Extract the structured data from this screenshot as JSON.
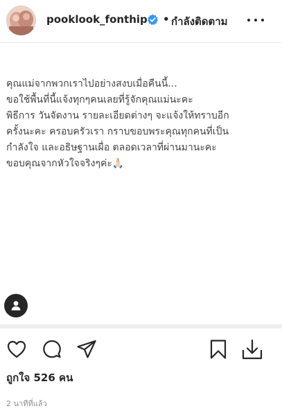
{
  "header": {
    "username": "pooklook_fonthip",
    "verified_icon": "verified-badge-icon",
    "separator": "•",
    "follow_status": "กำลังติดตาม",
    "more_icon": "more-options-icon"
  },
  "post": {
    "caption_lines": [
      "คุณแม่จากพวกเราไปอย่างสงบเมื่อคืนนี้...",
      "ขอใช้พื้นที่นี้แจ้งทุกๆคนเลยที่รู้จักคุณแม่นะคะ",
      "พิธีการ วันจัดงาน รายละเอียดต่างๆ จะแจ้งให้ทราบอีก",
      "ครั้งนะคะ ครอบครัวเรา กราบขอบพระคุณทุกคนที่เป็น",
      "กำลังใจ และอธิษฐานเผื่อ ตลอดเวลาที่ผ่านมานะคะ",
      "ขอบคุณจากหัวใจจริงๆค่ะ🙏🏻"
    ],
    "tag_icon": "user-tag-icon"
  },
  "actions": {
    "like_icon": "heart-icon",
    "comment_icon": "comment-icon",
    "share_icon": "paper-plane-icon",
    "save_icon": "bookmark-icon",
    "download_icon": "download-icon"
  },
  "stats": {
    "likes_text": "ถูกใจ 526 คน",
    "timestamp": "2 นาทีที่แล้ว"
  },
  "colors": {
    "text": "#262626",
    "caption": "#444444",
    "muted": "#8e8e8e",
    "verified": "#3897f0",
    "divider": "#efefef"
  }
}
